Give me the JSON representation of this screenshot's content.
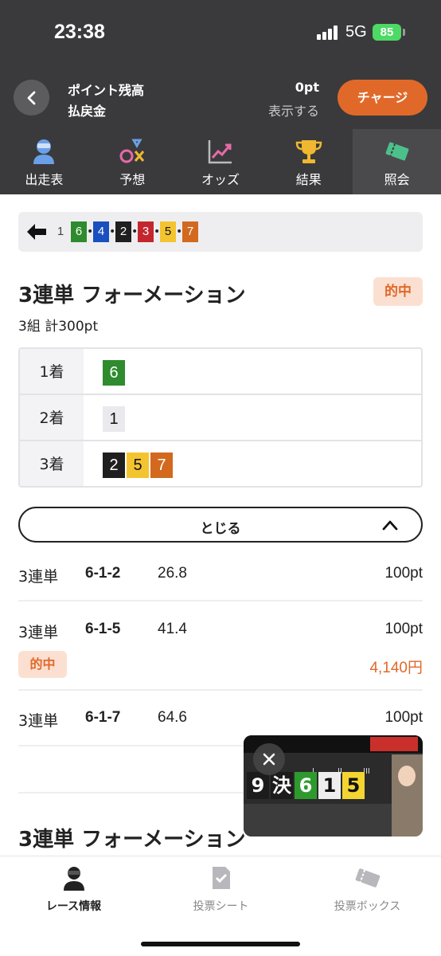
{
  "status_bar": {
    "time": "23:38",
    "network": "5G",
    "battery": "85"
  },
  "header": {
    "label_points": "ポイント残高",
    "label_refund": "払戻金",
    "points": "0pt",
    "show_label": "表示する",
    "charge_label": "チャージ"
  },
  "nav": {
    "tabs": [
      {
        "label": "出走表",
        "icon": "racer-icon"
      },
      {
        "label": "予想",
        "icon": "prediction-icon"
      },
      {
        "label": "オッズ",
        "icon": "odds-chart-icon"
      },
      {
        "label": "結果",
        "icon": "trophy-icon"
      },
      {
        "label": "照会",
        "icon": "ticket-icon",
        "active": true
      }
    ]
  },
  "race_order": [
    "1",
    "6",
    "4",
    "2",
    "3",
    "5",
    "7"
  ],
  "lane_colors": {
    "1": "#e9e9ee",
    "2": "#1f1f1f",
    "3": "#c4262d",
    "4": "#1a4fbf",
    "5": "#f4c430",
    "6": "#2e8b2e",
    "7": "#d2691e"
  },
  "section": {
    "title": "3連単 フォーメーション",
    "hit_badge": "的中",
    "subtitle": "3組 計300pt",
    "formation": [
      {
        "label": "1着",
        "numbers": [
          "6"
        ]
      },
      {
        "label": "2着",
        "numbers": [
          "1"
        ]
      },
      {
        "label": "3着",
        "numbers": [
          "2",
          "5",
          "7"
        ]
      }
    ],
    "close_label": "とじる"
  },
  "bets": [
    {
      "type": "3連単",
      "combo": "6-1-2",
      "odds": "26.8",
      "amount": "100pt"
    },
    {
      "type": "3連単",
      "combo": "6-1-5",
      "odds": "41.4",
      "amount": "100pt",
      "hit_label": "的中",
      "payout": "4,140円"
    },
    {
      "type": "3連単",
      "combo": "6-1-7",
      "odds": "64.6",
      "amount": "100pt"
    }
  ],
  "section2_title": "3連単 フォーメーション",
  "video": {
    "board": [
      "9",
      "決",
      "6",
      "1",
      "5"
    ]
  },
  "tabbar": {
    "items": [
      {
        "label": "レース情報",
        "icon": "racer-icon"
      },
      {
        "label": "投票シート",
        "icon": "check-sheet-icon"
      },
      {
        "label": "投票ボックス",
        "icon": "ticket-box-icon"
      }
    ]
  }
}
